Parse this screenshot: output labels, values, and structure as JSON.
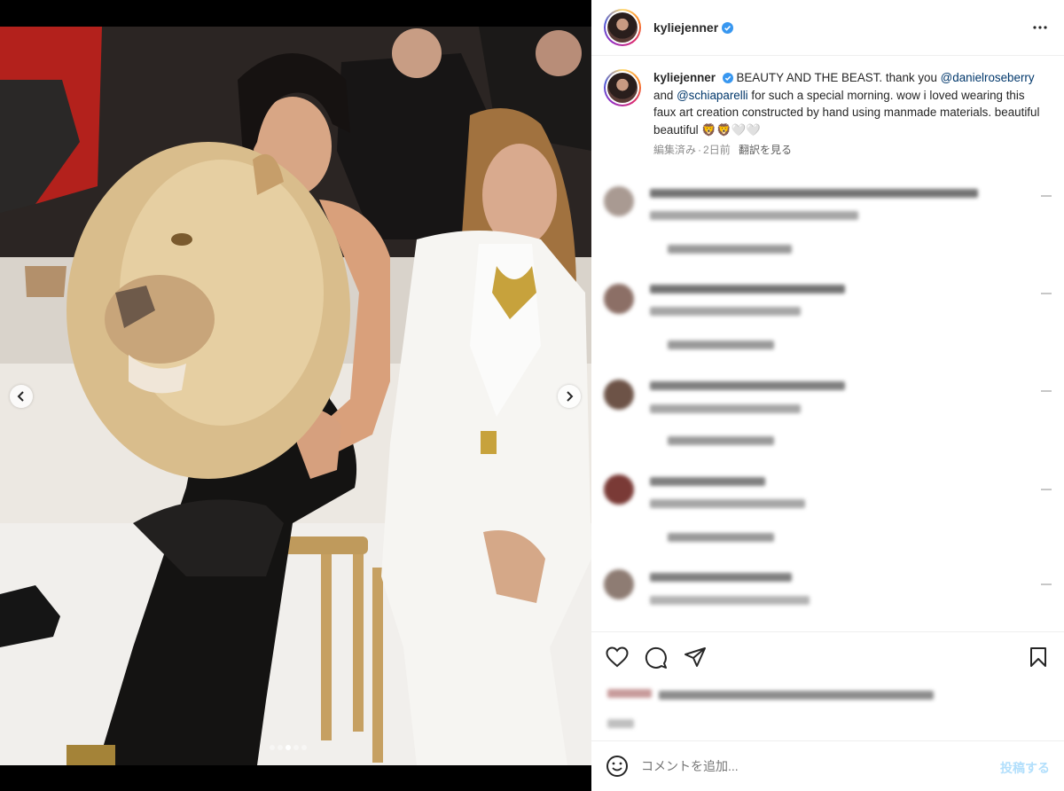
{
  "post": {
    "username": "kyliejenner",
    "verified": true,
    "more_icon": "more-horizontal-icon"
  },
  "caption": {
    "username": "kyliejenner",
    "text_1": "BEAUTY AND THE BEAST. thank you",
    "mention_1": "@danielroseberry",
    "text_2": "and",
    "mention_2": "@schiaparelli",
    "text_3": "for such a special morning. wow i loved wearing this faux art creation constructed by hand using manmade materials. beautiful beautiful 🦁🦁🤍🤍",
    "edited": "編集済み",
    "separator": "·",
    "age": "2日前",
    "translate": "翻訳を見る"
  },
  "carousel": {
    "prev_icon": "chevron-left-icon",
    "next_icon": "chevron-right-icon",
    "slide_count": 5,
    "active_index": 2
  },
  "actions": {
    "like_icon": "heart-icon",
    "comment_icon": "comment-icon",
    "share_icon": "send-icon",
    "save_icon": "bookmark-icon"
  },
  "comment_box": {
    "emoji_icon": "smiley-icon",
    "placeholder": "コメントを追加...",
    "post_label": "投稿する"
  },
  "colors": {
    "link": "#00376b",
    "muted": "#8e8e8e",
    "post_disabled": "#b2dffc",
    "verified_badge": "#3897f0"
  }
}
